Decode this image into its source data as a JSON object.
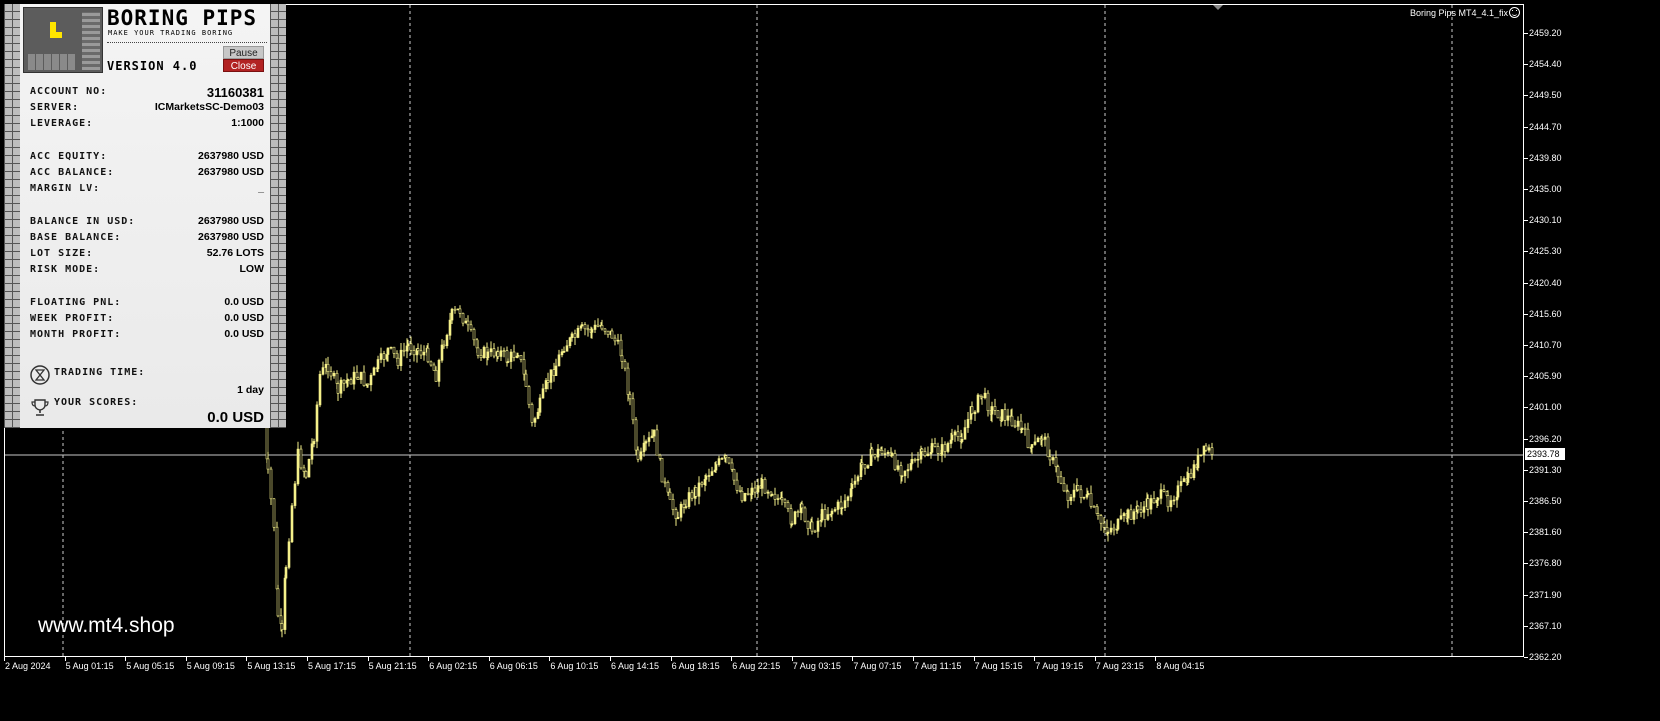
{
  "chart": {
    "caption": "Boring Pips MT4_4.1_fix",
    "current_price": "2393.78",
    "watermark": "www.mt4.shop",
    "price_axis": [
      "2459.20",
      "2454.40",
      "2449.50",
      "2444.70",
      "2439.80",
      "2435.00",
      "2430.10",
      "2425.30",
      "2420.40",
      "2415.60",
      "2410.70",
      "2405.90",
      "2401.00",
      "2396.20",
      "2391.30",
      "2386.50",
      "2381.60",
      "2376.80",
      "2371.90",
      "2367.10",
      "2362.20"
    ],
    "time_axis": [
      "2 Aug 2024",
      "5 Aug 01:15",
      "5 Aug 05:15",
      "5 Aug 09:15",
      "5 Aug 13:15",
      "5 Aug 17:15",
      "5 Aug 21:15",
      "6 Aug 02:15",
      "6 Aug 06:15",
      "6 Aug 10:15",
      "6 Aug 14:15",
      "6 Aug 18:15",
      "6 Aug 22:15",
      "7 Aug 03:15",
      "7 Aug 07:15",
      "7 Aug 11:15",
      "7 Aug 15:15",
      "7 Aug 19:15",
      "7 Aug 23:15",
      "8 Aug 04:15"
    ],
    "candle_color": "#f5f08a",
    "grid_color": "#ffffff",
    "background": "#000000"
  },
  "panel": {
    "brand_title": "BORING PIPS",
    "tagline": "MAKE YOUR TRADING BORING",
    "version": "VERSION 4.0",
    "pause_label": "Pause",
    "close_label": "Close",
    "stats": [
      {
        "label": "ACCOUNT NO:",
        "value": "31160381"
      },
      {
        "label": "SERVER:",
        "value": "ICMarketsSC-Demo03"
      },
      {
        "label": "LEVERAGE:",
        "value": "1:1000"
      },
      {
        "label": "ACC EQUITY:",
        "value": "2637980 USD"
      },
      {
        "label": "ACC BALANCE:",
        "value": "2637980 USD"
      },
      {
        "label": "MARGIN LV:",
        "value": "_"
      },
      {
        "label": "BALANCE IN USD:",
        "value": "2637980 USD"
      },
      {
        "label": "BASE BALANCE:",
        "value": "2637980 USD"
      },
      {
        "label": "LOT SIZE:",
        "value": "52.76 LOTS"
      },
      {
        "label": "RISK MODE:",
        "value": "LOW"
      },
      {
        "label": "FLOATING PNL:",
        "value": "0.0 USD"
      },
      {
        "label": "WEEK PROFIT:",
        "value": "0.0 USD"
      },
      {
        "label": "MONTH PROFIT:",
        "value": "0.0 USD"
      }
    ],
    "trading_time_label": "TRADING TIME:",
    "trading_time_value": "1 day",
    "scores_label": "YOUR SCORES:",
    "scores_value": "0.0 USD"
  }
}
